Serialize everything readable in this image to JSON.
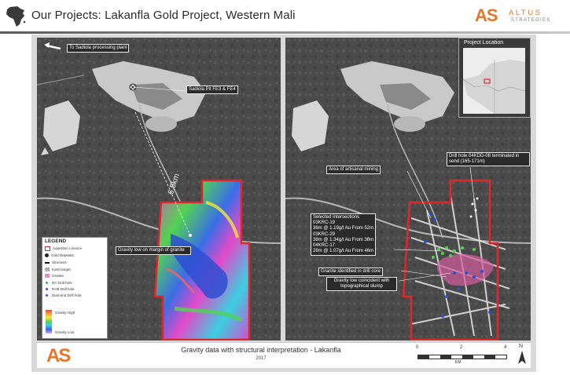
{
  "header": {
    "title": "Our Projects: Lakanfla Gold Project, Western Mali",
    "logo": {
      "mark": "AS",
      "brand": "ALTUS",
      "tagline": "STRATEGIES"
    }
  },
  "left_map": {
    "labels": {
      "plant": "To Sadiola processing plant",
      "pit": "Sadiola Pit FE3 & FE4",
      "distance": "6.5km",
      "gravity_low": "Gravity low on margin of granite"
    },
    "legend": {
      "title": "LEGEND",
      "items": [
        {
          "label": "Aquisition Licence",
          "icon": "red-outline-square-icon"
        },
        {
          "label": "Gold Deposits",
          "icon": "pickaxe-icon"
        },
        {
          "label": "Structure",
          "icon": "black-line-icon"
        },
        {
          "label": "Karst target",
          "icon": "hatched-square-icon"
        },
        {
          "label": "Granite",
          "icon": "pink-hatch-icon"
        },
        {
          "label": "RC Drill hole",
          "icon": "green-dot-icon"
        },
        {
          "label": "RAB Drill hole",
          "icon": "blue-dot-icon"
        },
        {
          "label": "Diamond Drill hole",
          "icon": "purple-dot-icon"
        }
      ],
      "gravity_high": "Gravity High",
      "gravity_low": "Gravity Low"
    }
  },
  "right_map": {
    "inset_title": "Project Location",
    "labels": {
      "drill_hole": "Drill hole 04KDD-08 terminated in send (165-171m)",
      "artisanal": "Area of artisanal mining",
      "intersections": [
        "Selected Intersections",
        "03KRC-19",
        "36m @ 1.19g/t Au From 52m",
        "03KRC-29",
        "38m @ 1.34g/t Au From 38m",
        "04KRC-17",
        "26m @ 1.07g/t Au From 46m"
      ],
      "granite": "Granite identified in drill core",
      "gravity_low": "Gravity low coincident with topographical slump"
    }
  },
  "caption": {
    "logo": "AS",
    "title": "Gravity data with structural interpretation - Lakanfla",
    "year": "2017",
    "scale_ticks": [
      "0",
      "2",
      "4"
    ],
    "scale_unit": "KM",
    "north": "N"
  },
  "colors": {
    "accent": "#e6762b",
    "licence": "#e0262b"
  }
}
